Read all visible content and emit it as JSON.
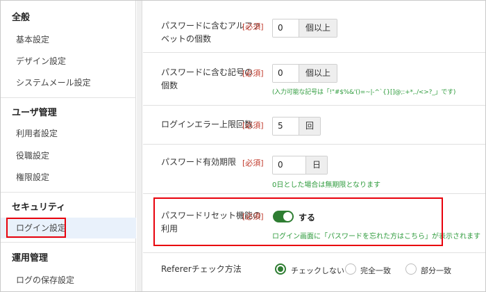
{
  "sidebar": {
    "sections": [
      {
        "title": "全般",
        "items": [
          "基本設定",
          "デザイン設定",
          "システムメール設定"
        ]
      },
      {
        "title": "ユーザ管理",
        "items": [
          "利用者設定",
          "役職設定",
          "権限設定"
        ]
      },
      {
        "title": "セキュリティ",
        "items": [
          "ログイン設定"
        ]
      },
      {
        "title": "運用管理",
        "items": [
          "ログの保存設定"
        ]
      }
    ]
  },
  "form": {
    "required_tag": "[必須]",
    "rows": [
      {
        "label_line1": "パスワードに含むアルファ",
        "label_line2": "ベットの個数",
        "value": "0",
        "unit": "個以上"
      },
      {
        "label_line1": "パスワードに含む記号の",
        "label_line2": "個数",
        "value": "0",
        "unit": "個以上",
        "hint": "(入力可能な記号は「!\"#$%&'()=~|-^`{}[]@;:+*,./<>?_」です)"
      },
      {
        "label_line1": "ログインエラー上限回数",
        "value": "5",
        "unit": "回"
      },
      {
        "label_line1": "パスワード有効期限",
        "value": "0",
        "unit": "日",
        "hint": "0日とした場合は無期限となります"
      },
      {
        "label_line1": "パスワードリセット機能の",
        "label_line2": "利用",
        "toggle_label": "する",
        "toggle_on": true,
        "hint": "ログイン画面に「パスワードを忘れた方はこちら」が表示されます"
      },
      {
        "label_line1": "Refererチェック方法",
        "options": [
          "チェックしない",
          "完全一致",
          "部分一致"
        ],
        "selected": "チェックしない"
      }
    ]
  },
  "colors": {
    "accent_green": "#2e7d32",
    "required_red": "#c0392b",
    "highlight_red": "#e8000b"
  }
}
